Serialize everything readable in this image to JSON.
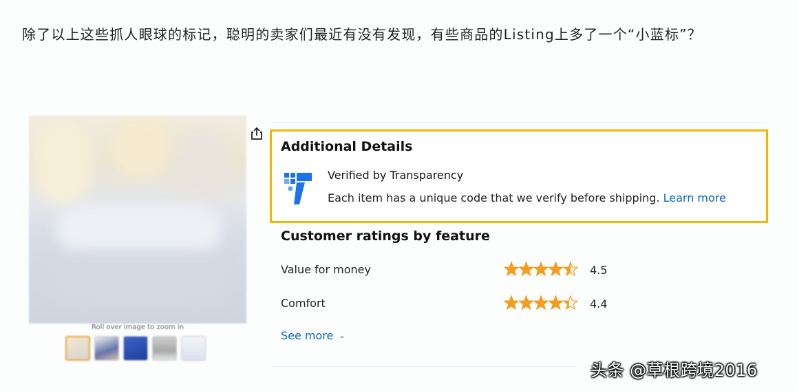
{
  "article": {
    "paragraph": "除了以上这些抓人眼球的标记，聪明的卖家们最近有没有发现，有些商品的Listing上多了一个“小蓝标”？"
  },
  "product_images": {
    "zoom_hint": "Roll over image to zoom in",
    "thumbnail_count": 5
  },
  "additional_details": {
    "title": "Additional Details",
    "verified_title": "Verified by Transparency",
    "verified_desc": "Each item has a unique code that we verify before shipping.",
    "learn_more": "Learn more",
    "highlight_color": "#f2b600",
    "logo_color": "#1a73e8"
  },
  "ratings": {
    "title": "Customer ratings by feature",
    "items": [
      {
        "label": "Value for money",
        "value": "4.5",
        "rating": 4.5
      },
      {
        "label": "Comfort",
        "value": "4.4",
        "rating": 4.4
      }
    ],
    "star_color": "#f59d1e",
    "see_more": "See more"
  },
  "watermark": "头条 @草根跨境2016"
}
